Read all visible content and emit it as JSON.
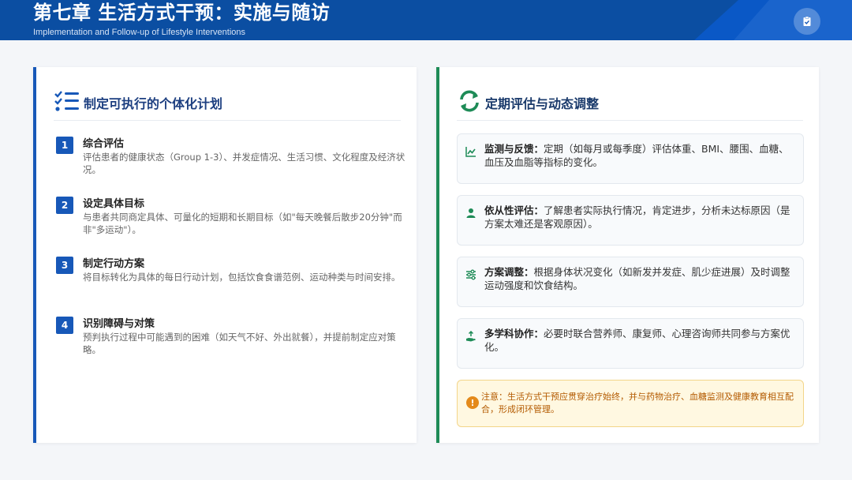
{
  "header": {
    "title": "第七章 生活方式干预：实施与随访",
    "subtitle": "Implementation and Follow-up of Lifestyle Interventions",
    "badge_icon": "clipboard-check-icon"
  },
  "left_panel": {
    "heading": "制定可执行的个体化计划",
    "icon": "checklist-icon",
    "steps": [
      {
        "num": "1",
        "title": "综合评估",
        "desc": "评估患者的健康状态（Group 1-3）、并发症情况、生活习惯、文化程度及经济状况。"
      },
      {
        "num": "2",
        "title": "设定具体目标",
        "desc": "与患者共同商定具体、可量化的短期和长期目标（如\"每天晚餐后散步20分钟\"而非\"多运动\"）。"
      },
      {
        "num": "3",
        "title": "制定行动方案",
        "desc": "将目标转化为具体的每日行动计划，包括饮食食谱范例、运动种类与时间安排。"
      },
      {
        "num": "4",
        "title": "识别障碍与对策",
        "desc": "预判执行过程中可能遇到的困难（如天气不好、外出就餐），并提前制定应对策略。"
      }
    ]
  },
  "right_panel": {
    "heading": "定期评估与动态调整",
    "icon": "sync-icon",
    "items": [
      {
        "icon": "chart-line-icon",
        "label": "监测与反馈：",
        "text": "定期（如每月或每季度）评估体重、BMI、腰围、血糖、血压及血脂等指标的变化。"
      },
      {
        "icon": "user-check-icon",
        "label": "依从性评估：",
        "text": "了解患者实际执行情况，肯定进步，分析未达标原因（是方案太难还是客观原因）。"
      },
      {
        "icon": "sliders-icon",
        "label": "方案调整：",
        "text": "根据身体状况变化（如新发并发症、肌少症进展）及时调整运动强度和饮食结构。"
      },
      {
        "icon": "hands-helping-icon",
        "label": "多学科协作：",
        "text": "必要时联合营养师、康复师、心理咨询师共同参与方案优化。"
      }
    ],
    "note": {
      "icon": "exclamation-circle-icon",
      "text": "注意：生活方式干预应贯穿治疗始终，并与药物治疗、血糖监测及健康教育相互配合，形成闭环管理。"
    }
  },
  "colors": {
    "header_bg": "#0b4ea2",
    "left_accent": "#1758b8",
    "right_accent": "#1e8b57",
    "note_bg": "#fff8e1",
    "note_text": "#b35a00"
  }
}
